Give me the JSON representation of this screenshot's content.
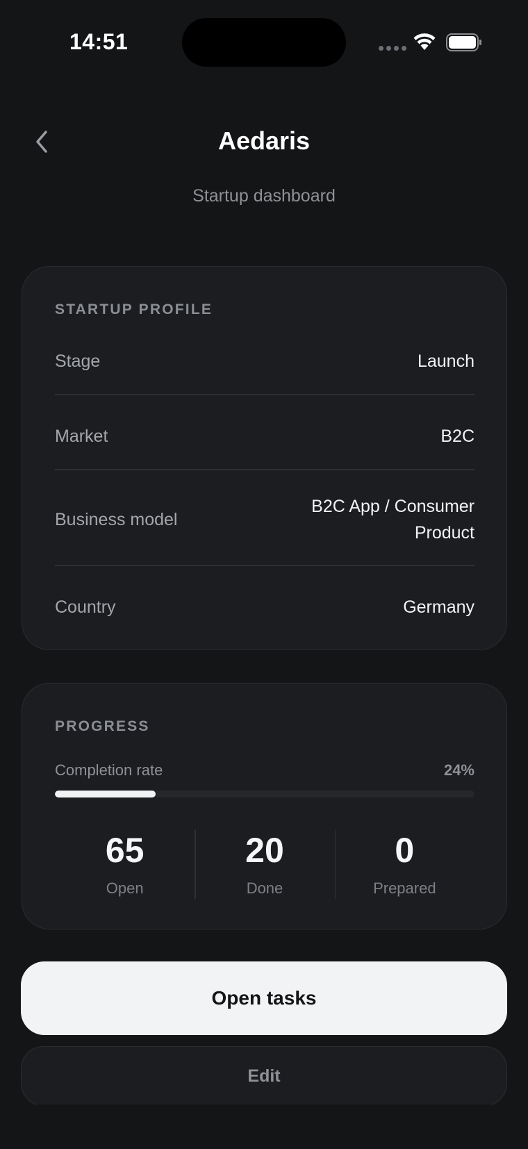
{
  "status_bar": {
    "time": "14:51",
    "icons": [
      "cellular-dots-icon",
      "wifi-icon",
      "battery-icon"
    ]
  },
  "header": {
    "back_icon": "chevron-left-icon",
    "title": "Aedaris",
    "subtitle": "Startup dashboard"
  },
  "profile": {
    "section_label": "STARTUP PROFILE",
    "rows": [
      {
        "label": "Stage",
        "value": "Launch"
      },
      {
        "label": "Market",
        "value": "B2C"
      },
      {
        "label": "Business model",
        "value": "B2C App / Consumer Product"
      },
      {
        "label": "Country",
        "value": "Germany"
      }
    ]
  },
  "progress": {
    "section_label": "PROGRESS",
    "completion_label": "Completion rate",
    "completion_value": "24%",
    "completion_fraction": 0.24,
    "stats": [
      {
        "value": "65",
        "label": "Open"
      },
      {
        "value": "20",
        "label": "Done"
      },
      {
        "value": "0",
        "label": "Prepared"
      }
    ]
  },
  "actions": {
    "primary_label": "Open tasks",
    "secondary_label": "Edit"
  },
  "colors": {
    "background": "#141517",
    "card": "#1c1d20",
    "primary_button": "#f2f3f5",
    "progress_fill": "#f2f3f5"
  }
}
